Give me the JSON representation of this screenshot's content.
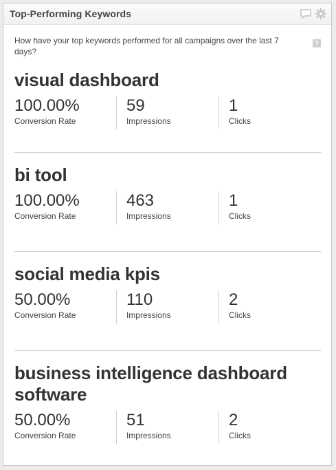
{
  "widget": {
    "title": "Top-Performing Keywords",
    "question": "How have your top keywords performed for all campaigns over the last 7 days?",
    "help_glyph": "?",
    "icons": [
      "comment-icon",
      "gear-icon",
      "help-icon"
    ]
  },
  "keywords": [
    {
      "name": "visual dashboard",
      "metrics": [
        {
          "value": "100.00%",
          "label": "Conversion Rate"
        },
        {
          "value": "59",
          "label": "Impressions"
        },
        {
          "value": "1",
          "label": "Clicks"
        }
      ]
    },
    {
      "name": "bi tool",
      "metrics": [
        {
          "value": "100.00%",
          "label": "Conversion Rate"
        },
        {
          "value": "463",
          "label": "Impressions"
        },
        {
          "value": "1",
          "label": "Clicks"
        }
      ]
    },
    {
      "name": "social media kpis",
      "metrics": [
        {
          "value": "50.00%",
          "label": "Conversion Rate"
        },
        {
          "value": "110",
          "label": "Impressions"
        },
        {
          "value": "2",
          "label": "Clicks"
        }
      ]
    },
    {
      "name": "business intelligence dashboard software",
      "metrics": [
        {
          "value": "50.00%",
          "label": "Conversion Rate"
        },
        {
          "value": "51",
          "label": "Impressions"
        },
        {
          "value": "2",
          "label": "Clicks"
        }
      ]
    }
  ]
}
